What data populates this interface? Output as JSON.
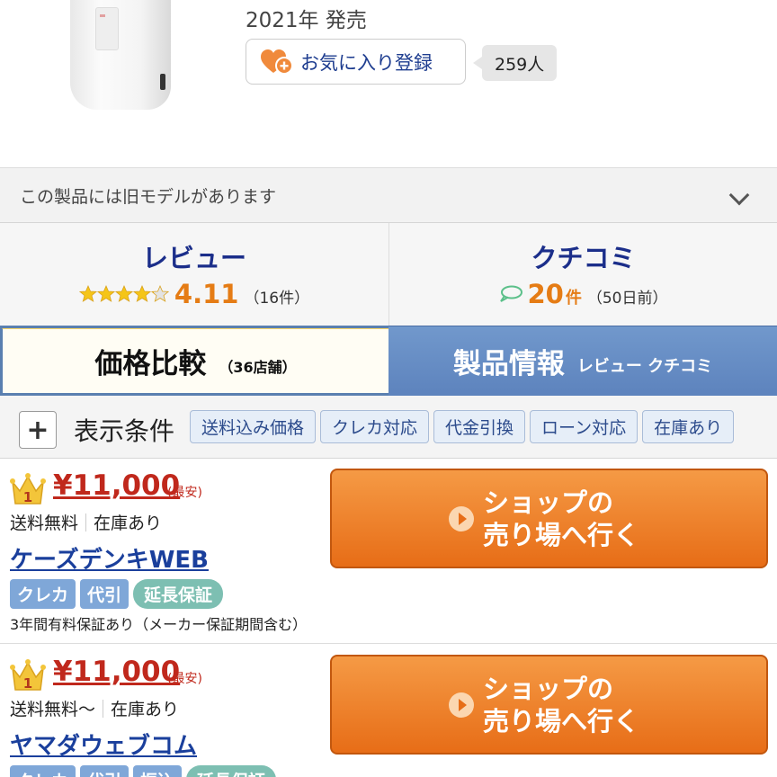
{
  "product": {
    "release": "2021年 発売",
    "favorite_label": "お気に入り登録",
    "favorite_count": "259人"
  },
  "old_model": {
    "text": "この製品には旧モデルがあります"
  },
  "review": {
    "title": "レビュー",
    "score": "4.11",
    "count": "（16件）",
    "stars": 4.11
  },
  "kuchikomi": {
    "title": "クチコミ",
    "count": "20",
    "unit": "件",
    "age": "（50日前）"
  },
  "tabs": {
    "price_compare": "価格比較",
    "shop_count": "（36店舗）",
    "product_info": "製品情報",
    "product_info_sub": "レビュー クチコミ"
  },
  "filters": {
    "label": "表示条件",
    "chips": [
      "送料込み価格",
      "クレカ対応",
      "代金引換",
      "ローン対応",
      "在庫あり"
    ]
  },
  "shops": [
    {
      "rank": "1",
      "price": "¥11,000",
      "lowest": "(最安)",
      "shipping": "送料無料",
      "stock": "在庫あり",
      "name": "ケーズデンキWEB",
      "badges": [
        "クレカ",
        "代引"
      ],
      "badge_warranty": "延長保証",
      "note": "3年間有料保証あり（メーカー保証期間含む）",
      "button_line1": "ショップの",
      "button_line2": "売り場へ行く"
    },
    {
      "rank": "1",
      "price": "¥11,000",
      "lowest": "(最安)",
      "shipping": "送料無料～",
      "stock": "在庫あり",
      "name": "ヤマダウェブコム",
      "badges": [
        "クレカ",
        "代引",
        "振込"
      ],
      "badge_warranty": "延長保証",
      "button_line1": "ショップの",
      "button_line2": "売り場へ行く"
    }
  ],
  "colors": {
    "accent_orange": "#e76d17",
    "link_blue": "#1a3f9c",
    "price_red": "#c0281c",
    "tab_blue": "#5d83bd"
  }
}
